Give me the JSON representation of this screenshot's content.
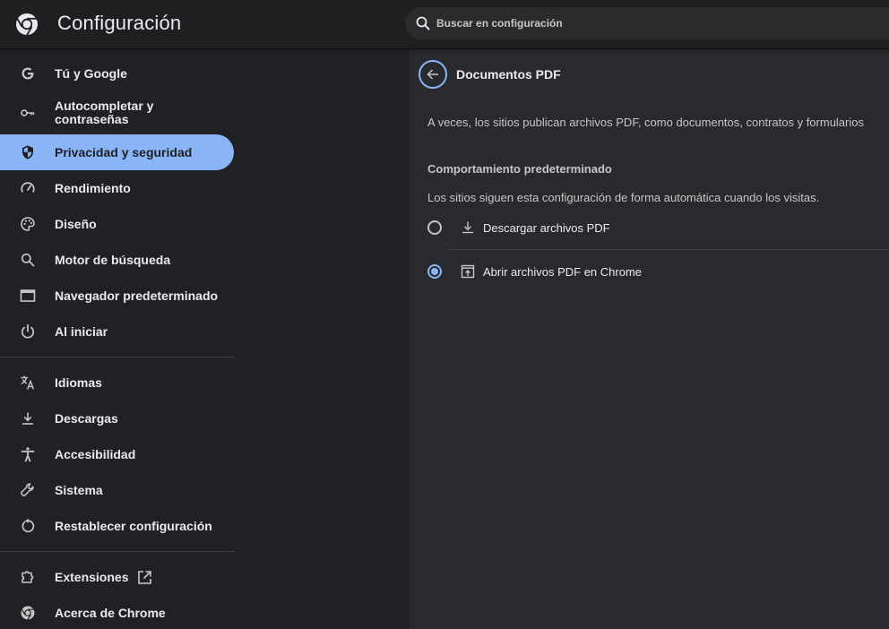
{
  "header": {
    "title": "Configuración",
    "search_placeholder": "Buscar en configuración"
  },
  "sidebar": {
    "items": [
      {
        "label": "Tú y Google",
        "icon": "google-g-icon"
      },
      {
        "label": "Autocompletar y contraseñas",
        "icon": "key-icon"
      },
      {
        "label": "Privacidad y seguridad",
        "icon": "shield-icon",
        "active": true
      },
      {
        "label": "Rendimiento",
        "icon": "speedometer-icon"
      },
      {
        "label": "Diseño",
        "icon": "palette-icon"
      },
      {
        "label": "Motor de búsqueda",
        "icon": "search-icon"
      },
      {
        "label": "Navegador predeterminado",
        "icon": "browser-window-icon"
      },
      {
        "label": "Al iniciar",
        "icon": "power-icon"
      },
      {
        "label": "Idiomas",
        "icon": "translate-icon"
      },
      {
        "label": "Descargas",
        "icon": "download-icon"
      },
      {
        "label": "Accesibilidad",
        "icon": "accessibility-icon"
      },
      {
        "label": "Sistema",
        "icon": "wrench-icon"
      },
      {
        "label": "Restablecer configuración",
        "icon": "reset-icon"
      },
      {
        "label": "Extensiones",
        "icon": "puzzle-icon"
      },
      {
        "label": "Acerca de Chrome",
        "icon": "chrome-icon"
      }
    ]
  },
  "main": {
    "title": "Documentos PDF",
    "description": "A veces, los sitios publican archivos PDF, como documentos, contratos y formularios",
    "section_heading": "Comportamiento predeterminado",
    "section_sub": "Los sitios siguen esta configuración de forma automática cuando los visitas.",
    "options": [
      {
        "label": "Descargar archivos PDF",
        "icon": "download-icon",
        "selected": false
      },
      {
        "label": "Abrir archivos PDF en Chrome",
        "icon": "open-in-browser-icon",
        "selected": true
      }
    ]
  },
  "colors": {
    "accent": "#8ab4f8",
    "background": "#202124",
    "panel": "#292a2d"
  }
}
